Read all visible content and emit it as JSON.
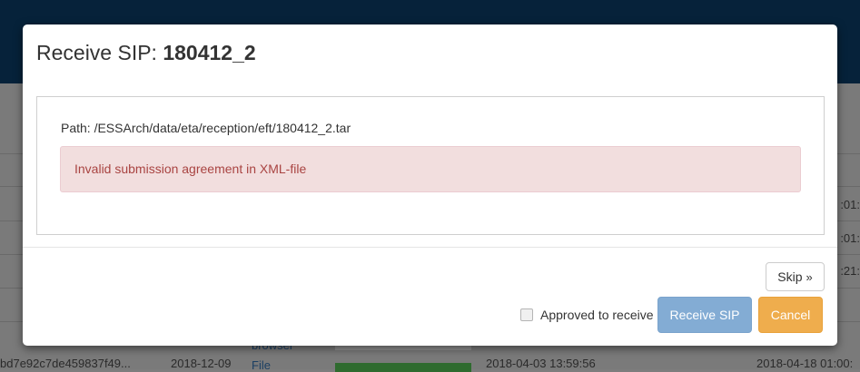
{
  "modal": {
    "title_prefix": "Receive SIP: ",
    "title_name": "180412_2",
    "path": "Path: /ESSArch/data/eta/reception/eft/180412_2.tar",
    "alert": "Invalid submission agreement in XML-file",
    "skip_label": "Skip",
    "approve_label": "Approved to receive",
    "receive_label": "Receive SIP",
    "cancel_label": "Cancel"
  },
  "background": {
    "row_times": [
      ":01:",
      ":01:",
      ":21:"
    ],
    "link_browser": "browser",
    "link_file": "File",
    "bottom_id": "bd7e92c7de459837f49...",
    "bottom_date1": "2018-12-09",
    "bottom_date2": "2018-04-03 13:59:56",
    "bottom_date3": "2018-04-18 01:00:"
  },
  "colors": {
    "topbar": "#06223a",
    "alert_bg": "#f2dede",
    "alert_text": "#a94442",
    "receive_btn": "#83acd4",
    "cancel_btn": "#efad4d"
  }
}
